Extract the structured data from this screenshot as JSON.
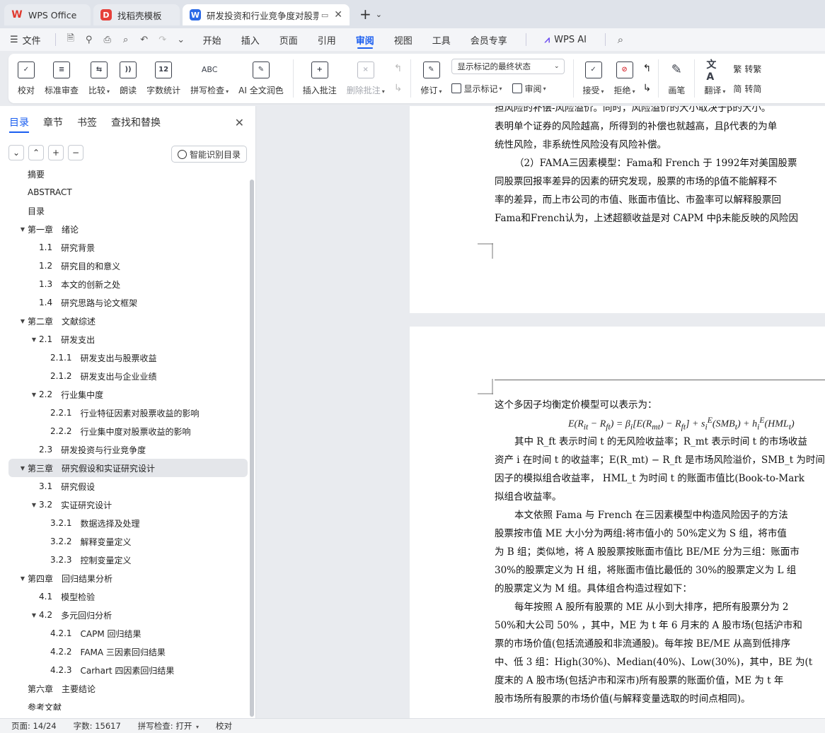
{
  "tabs": [
    {
      "label": "WPS Office",
      "icon": "wps-logo-icon"
    },
    {
      "label": "找稻壳模板",
      "icon": "docer-icon"
    },
    {
      "label": "研发投资和行业竞争度对股票收益的影响",
      "icon": "word-doc-icon",
      "active": true
    }
  ],
  "menubar": {
    "file": "文件",
    "tabs": [
      "开始",
      "插入",
      "页面",
      "引用",
      "审阅",
      "视图",
      "工具",
      "会员专享"
    ],
    "active_tab": "审阅",
    "ai_label": "WPS AI"
  },
  "ribbon": {
    "proofread": "校对",
    "std_review": "标准审查",
    "compare": "比较",
    "read_aloud": "朗读",
    "word_count": "字数统计",
    "word_count_glyph": "12",
    "spell_check": "拼写检查",
    "spell_glyph": "ABC",
    "ai_polish": "AI 全文润色",
    "insert_comment": "插入批注",
    "delete_comment": "删除批注",
    "track_changes": "修订",
    "markup_state": "显示标记的最终状态",
    "show_markup": "显示标记",
    "review": "审阅",
    "accept": "接受",
    "reject": "拒绝",
    "pen": "画笔",
    "translate": "翻译",
    "to_traditional": "转繁",
    "to_simplified": "转简"
  },
  "nav": {
    "tabs": [
      "目录",
      "章节",
      "书签",
      "查找和替换"
    ],
    "active_tab": "目录",
    "smart_toc": "智能识别目录",
    "items": [
      {
        "num": "",
        "text": "摘要",
        "level": 0
      },
      {
        "num": "",
        "text": "ABSTRACT",
        "level": 0
      },
      {
        "num": "",
        "text": "目录",
        "level": 0
      },
      {
        "num": "第一章",
        "text": "绪论",
        "level": 1,
        "expanded": true
      },
      {
        "num": "1.1",
        "text": "研究背景",
        "level": 2
      },
      {
        "num": "1.2",
        "text": "研究目的和意义",
        "level": 2
      },
      {
        "num": "1.3",
        "text": "本文的创新之处",
        "level": 2
      },
      {
        "num": "1.4",
        "text": "研究思路与论文框架",
        "level": 2
      },
      {
        "num": "第二章",
        "text": "文献综述",
        "level": 1,
        "expanded": true
      },
      {
        "num": "2.1",
        "text": "研发支出",
        "level": 2,
        "expanded": true
      },
      {
        "num": "2.1.1",
        "text": "研发支出与股票收益",
        "level": 3
      },
      {
        "num": "2.1.2",
        "text": "研发支出与企业业绩",
        "level": 3
      },
      {
        "num": "2.2",
        "text": "行业集中度",
        "level": 2,
        "expanded": true
      },
      {
        "num": "2.2.1",
        "text": "行业特征因素对股票收益的影响",
        "level": 3
      },
      {
        "num": "2.2.2",
        "text": "行业集中度对股票收益的影响",
        "level": 3
      },
      {
        "num": "2.3",
        "text": "研发投资与行业竞争度",
        "level": 2
      },
      {
        "num": "第三章",
        "text": "研究假设和实证研究设计",
        "level": 1,
        "expanded": true,
        "selected": true
      },
      {
        "num": "3.1",
        "text": "研究假设",
        "level": 2
      },
      {
        "num": "3.2",
        "text": "实证研究设计",
        "level": 2,
        "expanded": true
      },
      {
        "num": "3.2.1",
        "text": "数据选择及处理",
        "level": 3
      },
      {
        "num": "3.2.2",
        "text": "解释变量定义",
        "level": 3
      },
      {
        "num": "3.2.3",
        "text": "控制变量定义",
        "level": 3
      },
      {
        "num": "第四章",
        "text": "回归结果分析",
        "level": 1,
        "expanded": true
      },
      {
        "num": "4.1",
        "text": "模型检验",
        "level": 2
      },
      {
        "num": "4.2",
        "text": "多元回归分析",
        "level": 2,
        "expanded": true
      },
      {
        "num": "4.2.1",
        "text": "CAPM 回归结果",
        "level": 3
      },
      {
        "num": "4.2.2",
        "text": "FAMA 三因素回归结果",
        "level": 3
      },
      {
        "num": "4.2.3",
        "text": "Carhart 四因素回归结果",
        "level": 3
      },
      {
        "num": "第六章",
        "text": "主要结论",
        "level": 0
      },
      {
        "num": "",
        "text": "参考文献",
        "level": 0
      }
    ]
  },
  "document": {
    "page1_lines": [
      "担风险的补偿-风险溢价。同时，风险溢价的大小取决于β的大小。",
      "表明单个证券的风险越高，所得到的补偿也就越高，且β代表的为单",
      "统性风险，非系统性风险没有风险补偿。",
      "（2）FAMA三因素模型：Fama和 French 于 1992年对美国股票",
      "同股票回报率差异的因素的研究发现，股票的市场的β值不能解释不",
      "率的差异，而上市公司的市值、账面市值比、市盈率可以解释股票回",
      "Fama和French认为，上述超额收益是对 CAPM 中β未能反映的风险因"
    ],
    "page2_intro": "这个多因子均衡定价模型可以表示为：",
    "page2_lines": [
      "其中 R_ft 表示时间 t 的无风险收益率；R_mt 表示时间 t 的市场收益",
      "资产 i 在时间 t 的收益率；E(R_mt) − R_ft 是市场风险溢价，SMB_t 为时间 t",
      "因子的模拟组合收益率， HML_t 为时间 t 的账面市值比(Book-to-Mark",
      "拟组合收益率。",
      "本文依照 Fama 与 French 在三因素模型中构造风险因子的方法",
      "股票按市值 ME 大小分为两组:将市值小的 50%定义为 S 组，将市值",
      "为 B 组；类似地，将 A 股股票按账面市值比 BE/ME 分为三组：账面市",
      "30%的股票定义为 H 组，将账面市值比最低的 30%的股票定义为 L 组",
      "的股票定义为 M 组。具体组合构造过程如下：",
      "每年按照 A 股所有股票的 ME 从小到大排序，把所有股票分为 2",
      "50%和大公司 50% ，其中，ME 为 t 年 6 月末的 A 股市场(包括沪市和",
      "票的市场价值(包括流通股和非流通股)。每年按 BE/ME 从高到低排序",
      "中、低 3 组：High(30%)、Median(40%)、Low(30%)，其中，BE 为(t",
      "度末的 A 股市场(包括沪市和深市)所有股票的账面价值，ME 为 t 年",
      "股市场所有股票的市场价值(与解释变量选取的时间点相同)。"
    ]
  },
  "statusbar": {
    "page": "页面: 14/24",
    "words": "字数: 15617",
    "spell": "拼写检查: 打开",
    "proof": "校对"
  }
}
